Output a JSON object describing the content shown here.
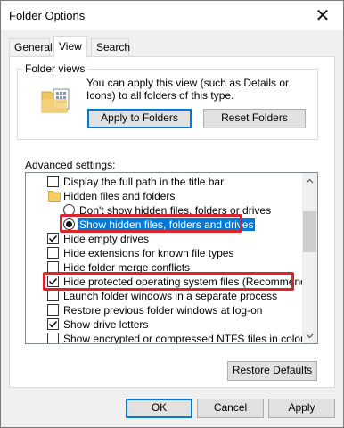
{
  "window": {
    "title": "Folder Options",
    "close_glyph": "✕"
  },
  "tabs": [
    {
      "label": "General",
      "active": false
    },
    {
      "label": "View",
      "active": true
    },
    {
      "label": "Search",
      "active": false
    }
  ],
  "folder_views": {
    "label": "Folder views",
    "description": "You can apply this view (such as Details or Icons) to all folders of this type.",
    "icon": "folder-icon",
    "apply_button": "Apply to Folders",
    "reset_button": "Reset Folders"
  },
  "advanced": {
    "label": "Advanced settings:",
    "items": [
      {
        "type": "checkbox",
        "checked": false,
        "label": "Display the full path in the title bar"
      },
      {
        "type": "folder",
        "label": "Hidden files and folders",
        "icon": "folder-icon"
      },
      {
        "type": "radio",
        "checked": false,
        "label": "Don't show hidden files, folders or drives"
      },
      {
        "type": "radio",
        "checked": true,
        "selected": true,
        "label": "Show hidden files, folders and drives"
      },
      {
        "type": "checkbox",
        "checked": true,
        "label": "Hide empty drives"
      },
      {
        "type": "checkbox",
        "checked": false,
        "label": "Hide extensions for known file types"
      },
      {
        "type": "checkbox",
        "checked": false,
        "label": "Hide folder merge conflicts"
      },
      {
        "type": "checkbox",
        "checked": true,
        "label": "Hide protected operating system files (Recommended)"
      },
      {
        "type": "checkbox",
        "checked": false,
        "label": "Launch folder windows in a separate process"
      },
      {
        "type": "checkbox",
        "checked": false,
        "label": "Restore previous folder windows at log-on"
      },
      {
        "type": "checkbox",
        "checked": true,
        "label": "Show drive letters"
      },
      {
        "type": "checkbox",
        "checked": false,
        "label": "Show encrypted or compressed NTFS files in colour"
      }
    ],
    "highlight_color": "#d9262c",
    "selection_color": "#0078d7"
  },
  "restore_defaults_button": "Restore Defaults",
  "footer": {
    "ok": "OK",
    "cancel": "Cancel",
    "apply": "Apply"
  }
}
